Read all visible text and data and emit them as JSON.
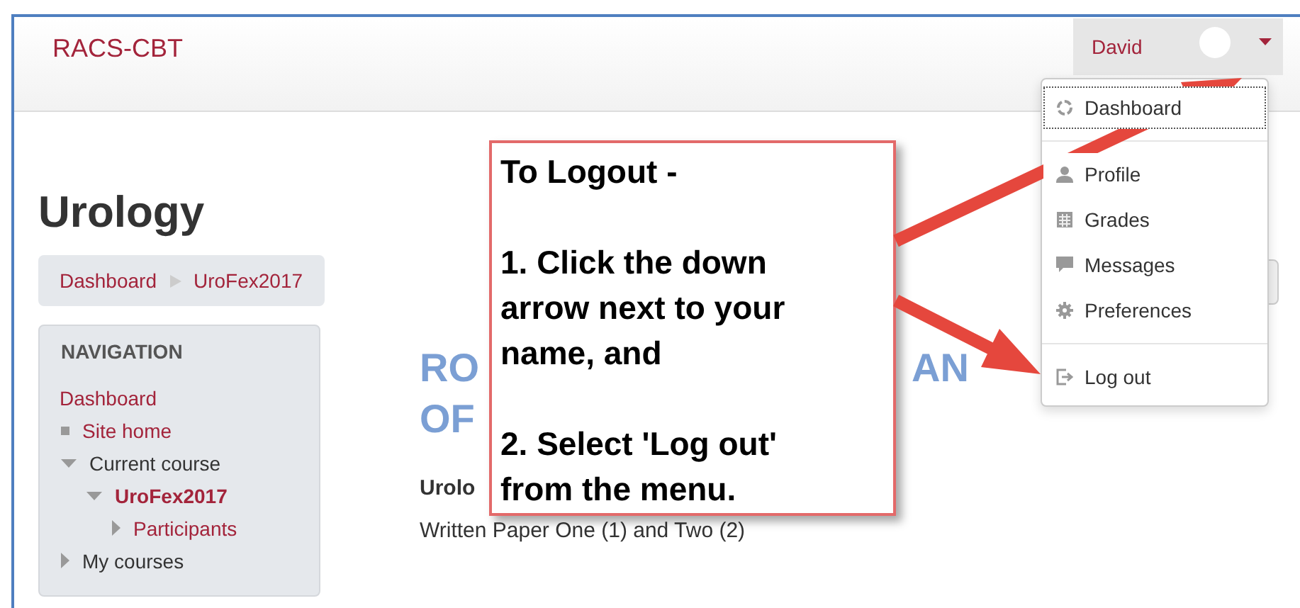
{
  "site": {
    "name": "RACS-CBT"
  },
  "user_menu": {
    "name": "David",
    "expanded": true,
    "sections": [
      {
        "items": [
          {
            "kind": "dashboard",
            "label": "Dashboard",
            "focused": true
          }
        ]
      },
      {
        "items": [
          {
            "kind": "profile",
            "label": "Profile",
            "focused": false
          },
          {
            "kind": "grades",
            "label": "Grades",
            "focused": false
          },
          {
            "kind": "messages",
            "label": "Messages",
            "focused": false
          },
          {
            "kind": "preferences",
            "label": "Preferences",
            "focused": false
          }
        ]
      },
      {
        "items": [
          {
            "kind": "logout",
            "label": "Log out",
            "focused": false
          }
        ]
      }
    ]
  },
  "page": {
    "title": "Urology",
    "breadcrumb": [
      {
        "label": "Dashboard"
      },
      {
        "label": "UroFex2017"
      }
    ]
  },
  "navigation": {
    "title": "NAVIGATION",
    "items": [
      {
        "label": "Dashboard",
        "kind": "plain",
        "link": true,
        "current": false
      },
      {
        "label": "Site home",
        "kind": "leaf",
        "link": true,
        "current": false
      },
      {
        "label": "Current course",
        "kind": "branch",
        "expanded": true,
        "link": false,
        "current": false,
        "children": [
          {
            "label": "UroFex2017",
            "kind": "branch",
            "expanded": true,
            "link": true,
            "current": true,
            "children": [
              {
                "label": "Participants",
                "kind": "branch",
                "expanded": false,
                "link": true,
                "current": false
              }
            ]
          }
        ]
      },
      {
        "label": "My courses",
        "kind": "branch",
        "expanded": false,
        "link": false,
        "current": false
      }
    ]
  },
  "main": {
    "heading_lines": [
      {
        "parts": [
          "RO",
          "AN"
        ]
      },
      {
        "parts": [
          "OF"
        ]
      }
    ],
    "subheading": "Urolo",
    "description": "Written Paper One (1) and Two (2)"
  },
  "callout": {
    "paragraphs": [
      "To Logout -",
      "1. Click the down arrow next to your name, and",
      "2. Select 'Log out' from the menu."
    ]
  }
}
